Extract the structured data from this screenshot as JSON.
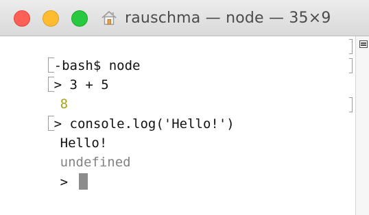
{
  "window": {
    "title": "rauschma — node — 35×9",
    "colors": {
      "close": "#fe5f57",
      "minimize": "#febc2e",
      "maximize": "#28c840"
    },
    "title_icon": "home-icon"
  },
  "terminal": {
    "lines": [
      {
        "text": "-bash$ node",
        "marked": true
      },
      {
        "text": "> 3 + 5",
        "marked": true
      },
      {
        "text": "8",
        "marked": false,
        "color": "#a7a21a"
      },
      {
        "text": "> console.log('Hello!')",
        "marked": true
      },
      {
        "text": "Hello!",
        "marked": false
      },
      {
        "text": "undefined",
        "marked": false,
        "color": "#828282"
      },
      {
        "text": "> ",
        "marked": false
      }
    ]
  },
  "scrollbar": {
    "icon": "split-pane-icon"
  }
}
